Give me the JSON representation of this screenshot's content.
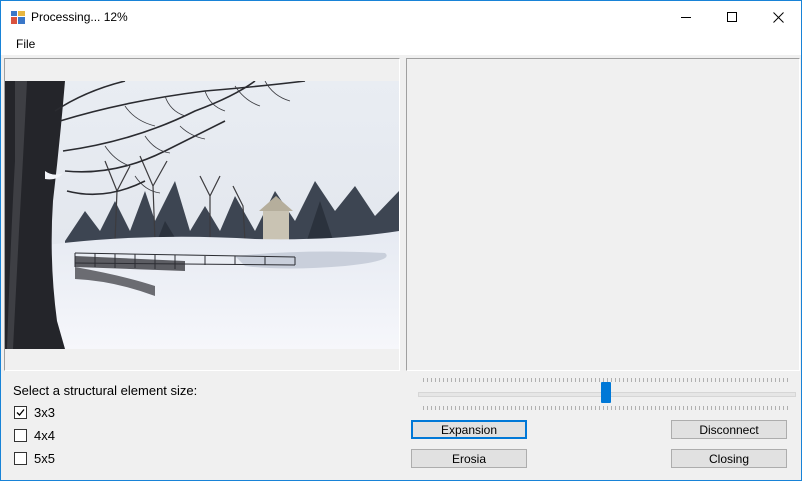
{
  "window": {
    "title": "Processing... 12%",
    "controls": [
      "minimize",
      "maximize",
      "close"
    ]
  },
  "menu": {
    "items": [
      {
        "label": "File"
      }
    ]
  },
  "structural": {
    "label": "Select a structural element size:",
    "options": [
      {
        "label": "3x3",
        "checked": true
      },
      {
        "label": "4x4",
        "checked": false
      },
      {
        "label": "5x5",
        "checked": false
      }
    ]
  },
  "buttons": {
    "expansion": "Expansion",
    "erosia": "Erosia",
    "disconnect": "Disconnect",
    "closing": "Closing"
  },
  "slider": {
    "value_fraction": 0.5
  },
  "colors": {
    "accent": "#0078d7",
    "window_border": "#1883d7",
    "background": "#f0f0f0"
  },
  "icons": {
    "app": "app-icon",
    "minimize": "minimize-icon",
    "maximize": "maximize-icon",
    "close": "close-icon",
    "check": "check-icon"
  }
}
